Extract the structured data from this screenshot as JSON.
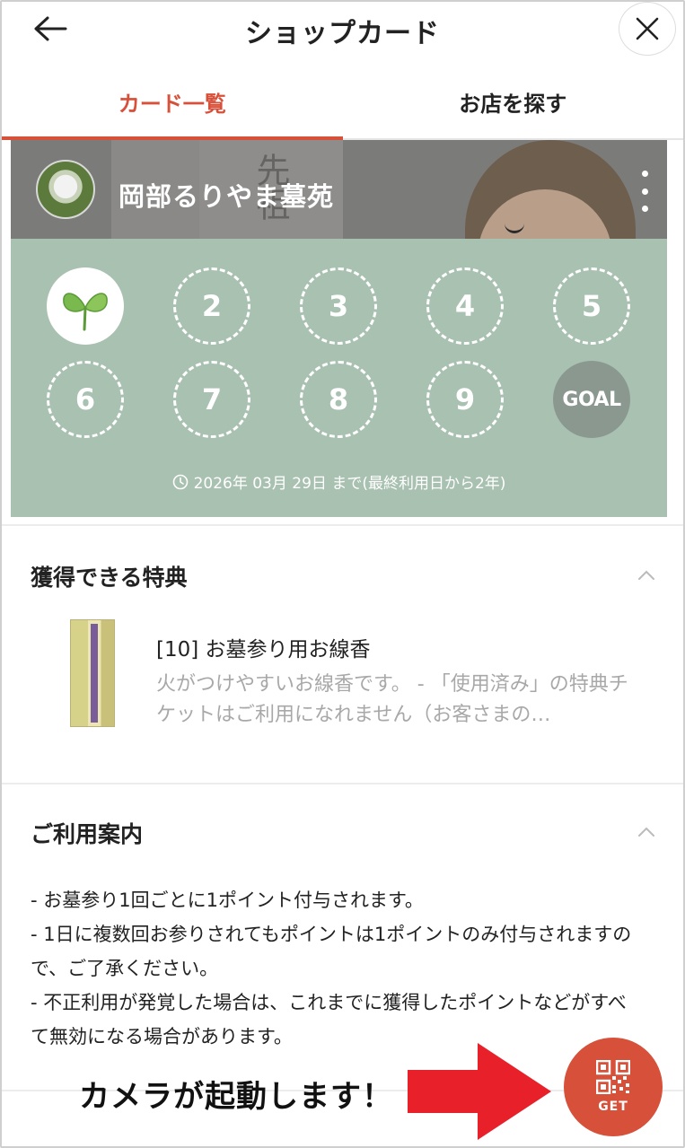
{
  "header": {
    "title": "ショップカード",
    "back_icon": "arrow-left-icon",
    "close_icon": "close-icon"
  },
  "tabs": [
    {
      "label": "カード一覧",
      "active": true
    },
    {
      "label": "お店を探す",
      "active": false
    }
  ],
  "card": {
    "shop_name": "岡部るりやま墓苑",
    "stamps": [
      {
        "label": "",
        "state": "stamped",
        "icon": "sprout-icon"
      },
      {
        "label": "2",
        "state": "empty"
      },
      {
        "label": "3",
        "state": "empty"
      },
      {
        "label": "4",
        "state": "empty"
      },
      {
        "label": "5",
        "state": "empty"
      },
      {
        "label": "6",
        "state": "empty"
      },
      {
        "label": "7",
        "state": "empty"
      },
      {
        "label": "8",
        "state": "empty"
      },
      {
        "label": "9",
        "state": "empty"
      },
      {
        "label": "GOAL",
        "state": "goal"
      }
    ],
    "expiry": "2026年 03月 29日 まで(最終利用日から2年)",
    "bg_color": "#a9c1b1"
  },
  "rewards": {
    "title": "獲得できる特典",
    "item_title": "[10] お墓参り用お線香",
    "item_desc": "火がつけやすいお線香です。 - 「使用済み」の特典チケットはご利用になれません（お客さまの…"
  },
  "guide": {
    "title": "ご利用案内",
    "lines": [
      "- お墓参り1回ごとに1ポイント付与されます。",
      "- 1日に複数回お参りされてもポイントは1ポイントのみ付与されますので、ご了承ください。",
      "- 不正利用が発覚した場合は、これまでに獲得したポイントなどがすべて無効になる場合があります。"
    ]
  },
  "callout": "カメラが起動します！",
  "get_button": {
    "label": "GET",
    "icon": "qr-code-icon"
  },
  "colors": {
    "accent": "#d6503a",
    "arrow": "#e8202a"
  }
}
